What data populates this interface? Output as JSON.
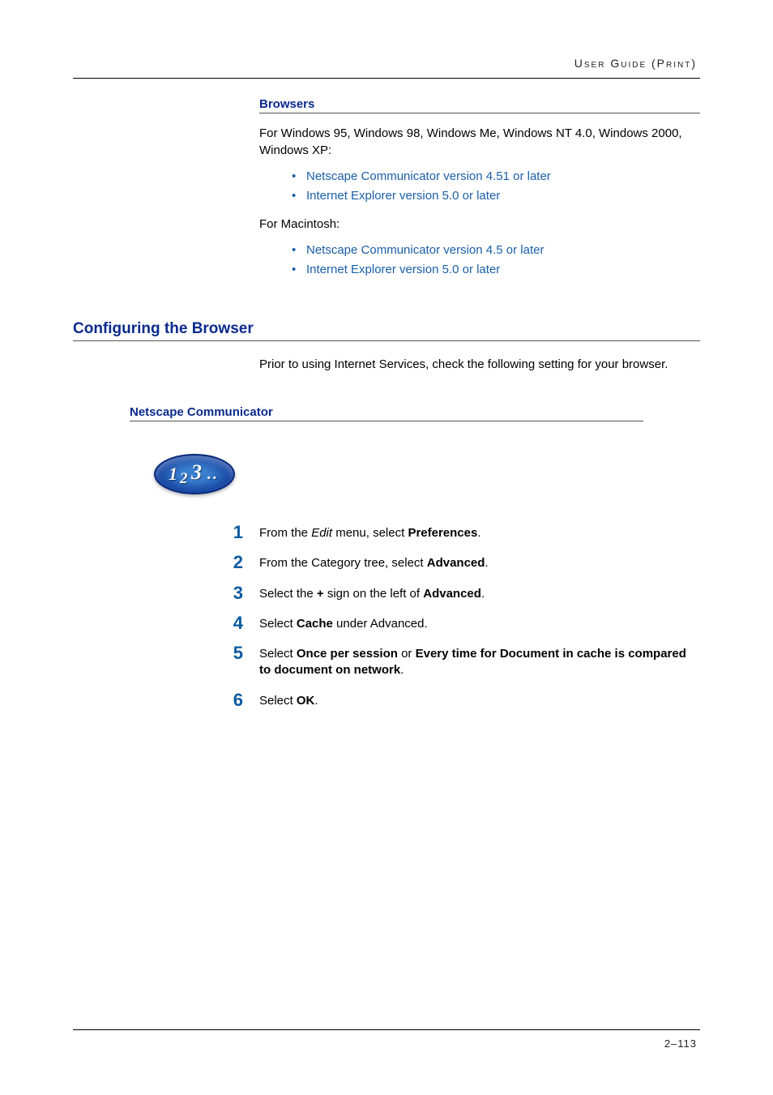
{
  "header": {
    "right": "User Guide (Print)"
  },
  "browsers": {
    "heading": "Browsers",
    "win_intro": "For Windows 95, Windows 98, Windows Me, Windows NT 4.0, Windows 2000, Windows XP:",
    "win_items": [
      "Netscape Communicator version 4.51 or later",
      "Internet Explorer version 5.0 or later"
    ],
    "mac_intro": "For Macintosh:",
    "mac_items": [
      "Netscape Communicator version 4.5 or later",
      "Internet Explorer version 5.0 or later"
    ]
  },
  "configuring": {
    "heading": "Configuring the Browser",
    "intro": "Prior to using Internet Services, check the following setting for your browser."
  },
  "netscape": {
    "heading": "Netscape Communicator",
    "steps": [
      {
        "pre": "From the ",
        "i": "Edit",
        "mid": " menu, select ",
        "b": "Preferences",
        "post": "."
      },
      {
        "pre": "From the Category tree, select ",
        "b": "Advanced",
        "post": "."
      },
      {
        "pre": "Select the ",
        "b": "+",
        "mid": " sign on the left of ",
        "b2": "Advanced",
        "post": "."
      },
      {
        "pre": "Select ",
        "b": "Cache",
        "post": " under Advanced."
      },
      {
        "pre": "Select ",
        "b": "Once per session",
        "mid": " or ",
        "b2": "Every time for Document in cache is compared to document on network",
        "post": "."
      },
      {
        "pre": "Select ",
        "b": "OK",
        "post": "."
      }
    ]
  },
  "footer": {
    "right": "2–113"
  }
}
